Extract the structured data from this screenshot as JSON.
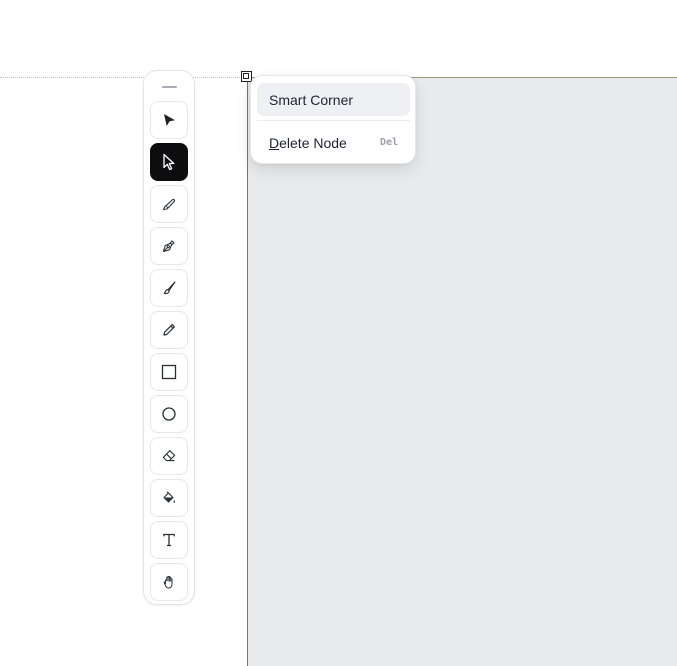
{
  "colors": {
    "canvas_bg": "#e9eaec",
    "active_tool_bg": "#0d0d0f",
    "menu_highlight": "#eff0f3",
    "text": "#1f2330",
    "shortcut_text": "#9b9fa8"
  },
  "toolbar": {
    "tools": [
      {
        "name": "select",
        "icon": "arrow-cursor-icon",
        "active": false
      },
      {
        "name": "direct-select",
        "icon": "pointer-outline-icon",
        "active": true
      },
      {
        "name": "knife",
        "icon": "knife-icon",
        "active": false
      },
      {
        "name": "pen",
        "icon": "pen-nib-icon",
        "active": false
      },
      {
        "name": "brush",
        "icon": "brush-icon",
        "active": false
      },
      {
        "name": "pencil",
        "icon": "pencil-icon",
        "active": false
      },
      {
        "name": "rectangle",
        "icon": "square-icon",
        "active": false
      },
      {
        "name": "ellipse",
        "icon": "circle-icon",
        "active": false
      },
      {
        "name": "eraser",
        "icon": "eraser-icon",
        "active": false
      },
      {
        "name": "fill",
        "icon": "paint-bucket-icon",
        "active": false
      },
      {
        "name": "text",
        "icon": "text-icon",
        "active": false
      },
      {
        "name": "hand",
        "icon": "hand-icon",
        "active": false
      }
    ]
  },
  "context_menu": {
    "items": [
      {
        "label": "Smart Corner",
        "shortcut": "",
        "highlighted": true
      },
      {
        "label_mnemonic": "D",
        "label_rest": "elete Node",
        "shortcut": "Del",
        "highlighted": false
      }
    ]
  }
}
